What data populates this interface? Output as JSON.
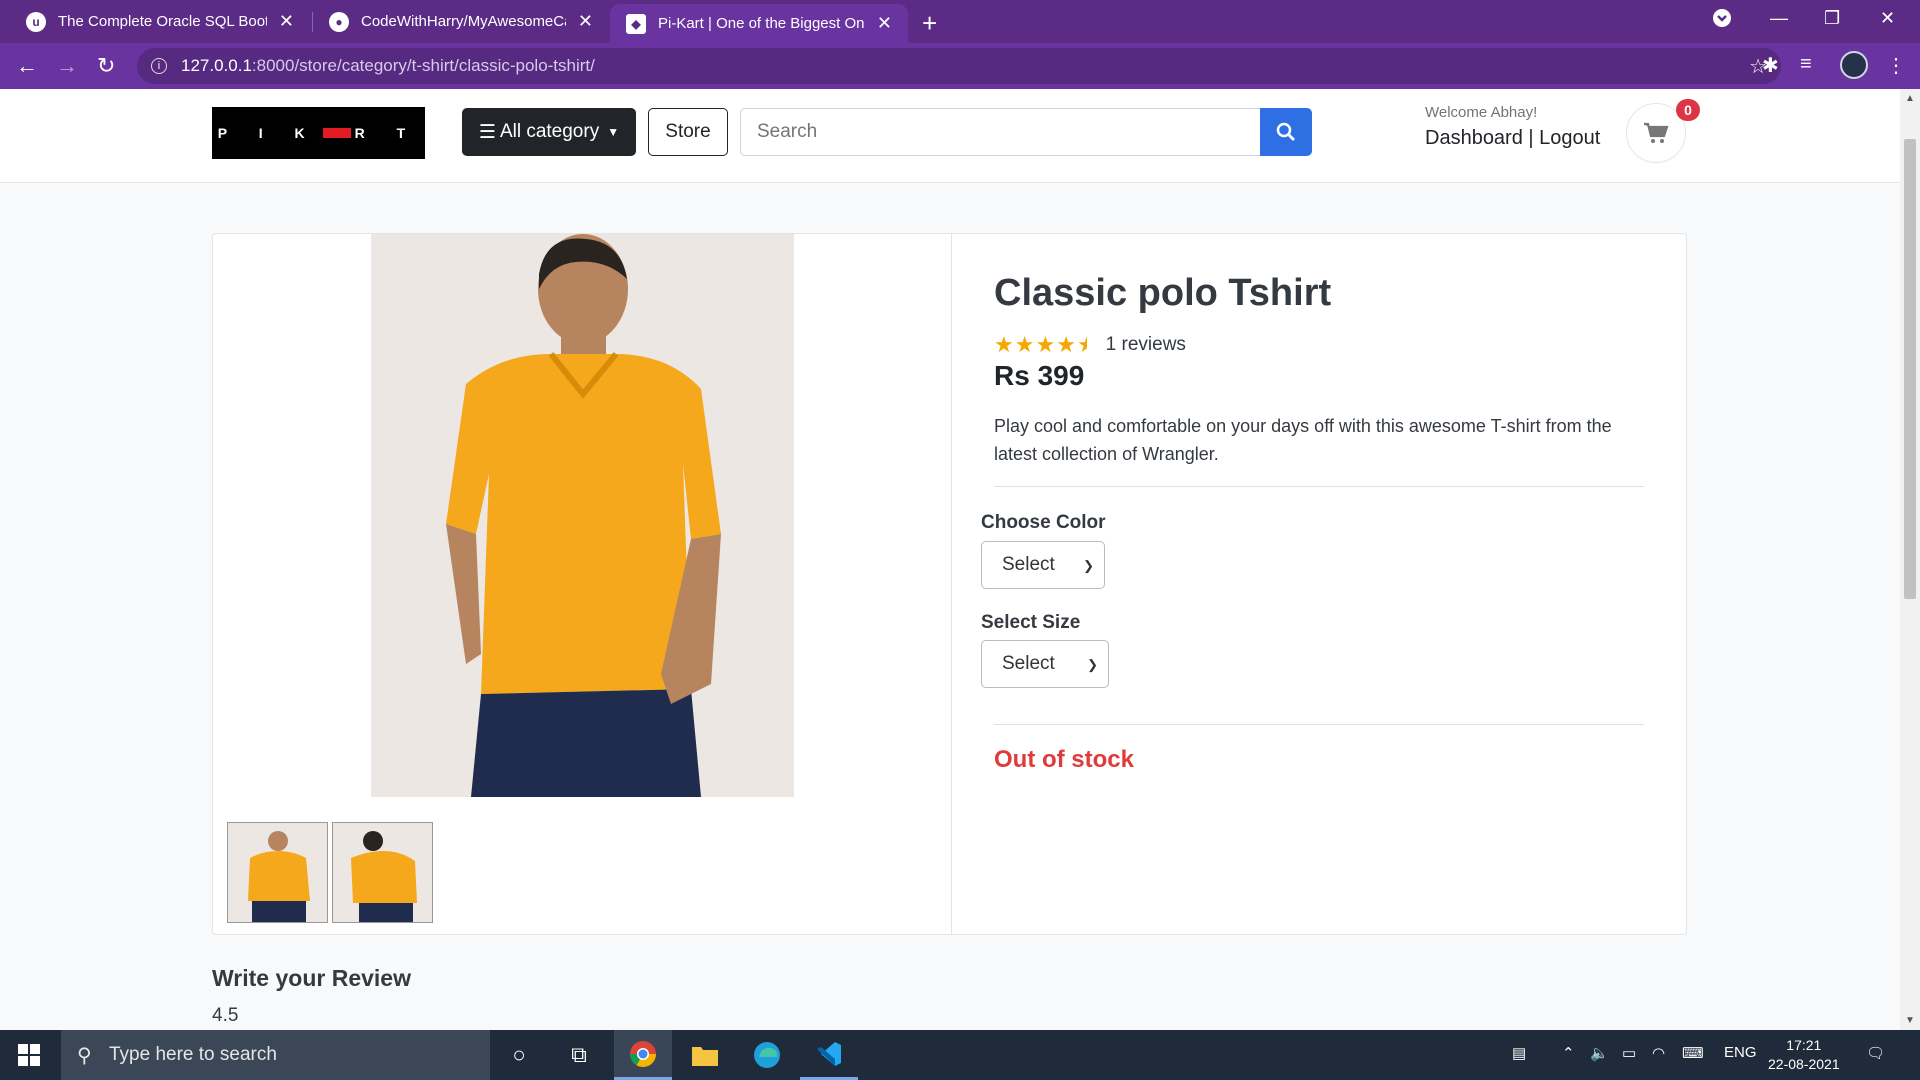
{
  "browser": {
    "tabs": [
      {
        "title": "The Complete Oracle SQL Bootcamp",
        "favicon": "udemy-icon"
      },
      {
        "title": "CodeWithHarry/MyAwesomeCart",
        "favicon": "github-icon"
      },
      {
        "title": "Pi-Kart | One of the Biggest Online",
        "favicon": "pikart-icon"
      }
    ],
    "url_host": "127.0.0.1",
    "url_path": ":8000/store/category/t-shirt/classic-polo-tshirt/"
  },
  "header": {
    "logo_text": "PIKART",
    "category_label": "All category",
    "store_label": "Store",
    "search_placeholder": "Search",
    "welcome": "Welcome Abhay!",
    "dashboard_label": "Dashboard",
    "separator": "|",
    "logout_label": "Logout",
    "cart_count": "0"
  },
  "product": {
    "title": "Classic polo Tshirt",
    "rating": 4.5,
    "reviews_label": "1 reviews",
    "price": "Rs 399",
    "description": "Play cool and comfortable on your days off with this awesome T-shirt from the latest collection of Wrangler.",
    "color_label": "Choose Color",
    "color_selected": "Select",
    "size_label": "Select Size",
    "size_selected": "Select",
    "stock_status": "Out of stock",
    "shirt_color": "#f5a81c"
  },
  "review": {
    "title": "Write your Review",
    "value": "4.5"
  },
  "taskbar": {
    "search_placeholder": "Type here to search",
    "language": "ENG",
    "time": "17:21",
    "date": "22-08-2021"
  },
  "colors": {
    "browser_frame": "#5b2b86",
    "search_button": "#2f6fe4",
    "out_of_stock": "#e03a3a",
    "star": "#f5a700"
  }
}
